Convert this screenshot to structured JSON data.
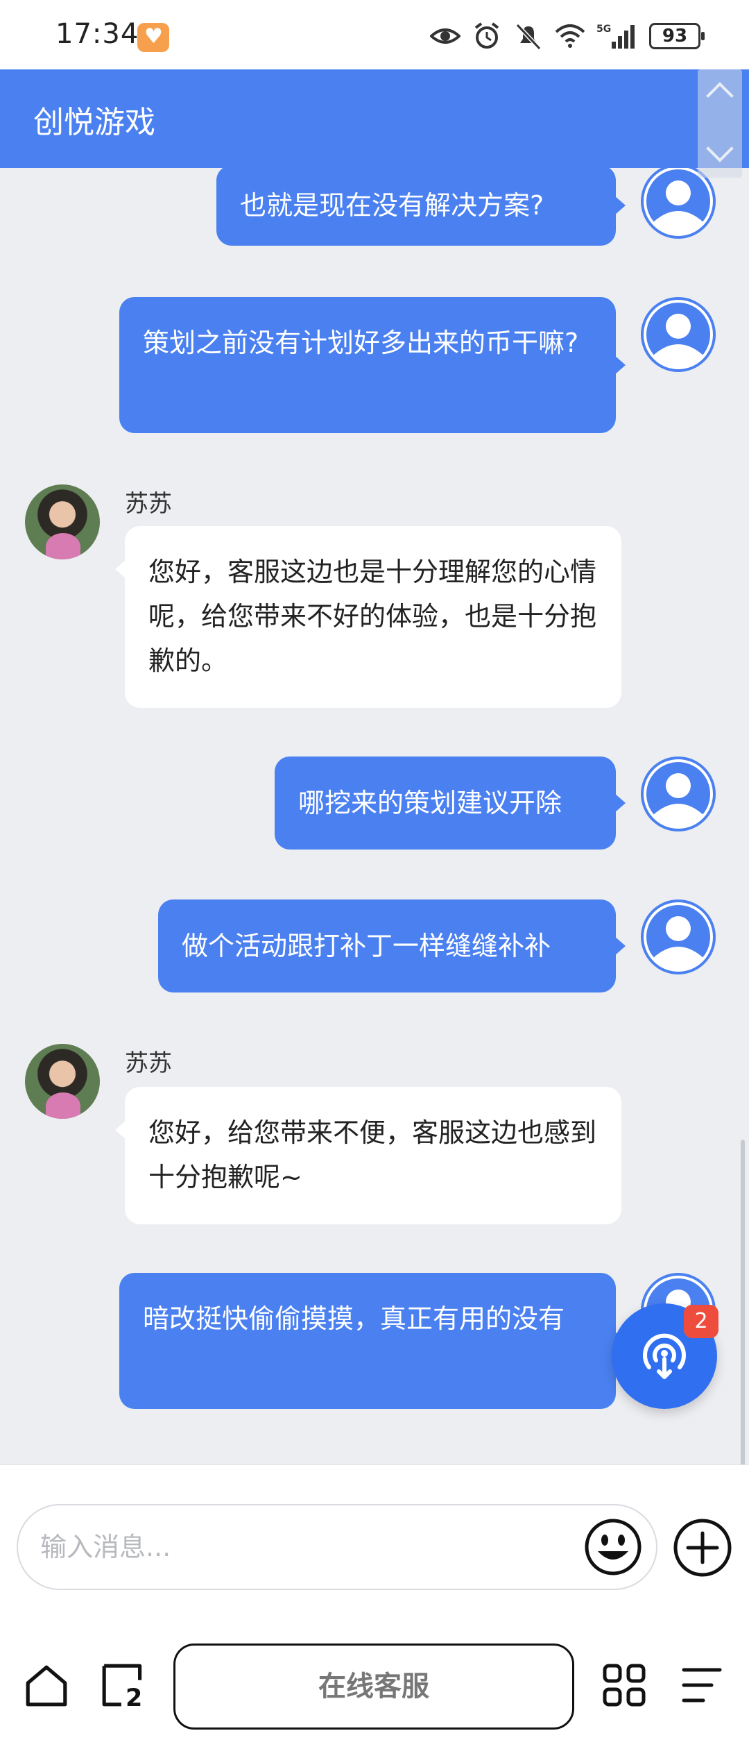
{
  "status_bar": {
    "time": "17:34",
    "battery": "93",
    "network": "5G"
  },
  "header": {
    "title": "创悦游戏"
  },
  "messages": [
    {
      "side": "out",
      "text": "也就是现在没有解决方案?"
    },
    {
      "side": "out",
      "text": "策划之前没有计划好多出来的币干嘛?"
    },
    {
      "side": "in",
      "sender": "苏苏",
      "text": "您好，客服这边也是十分理解您的心情呢，给您带来不好的体验，也是十分抱歉的。"
    },
    {
      "side": "out",
      "text": "哪挖来的策划建议开除"
    },
    {
      "side": "out",
      "text": "做个活动跟打补丁一样缝缝补补"
    },
    {
      "side": "in",
      "sender": "苏苏",
      "text": "您好，给您带来不便，客服这边也感到十分抱歉呢~"
    },
    {
      "side": "out",
      "text": "暗改挺快偷偷摸摸，真正有用的没有"
    }
  ],
  "floating": {
    "badge": "2"
  },
  "input": {
    "placeholder": "输入消息..."
  },
  "bottom_nav": {
    "kefu_label": "在线客服",
    "tabs_count": "2"
  },
  "colors": {
    "accent": "#4a80f0",
    "badge": "#ee4d3d"
  }
}
